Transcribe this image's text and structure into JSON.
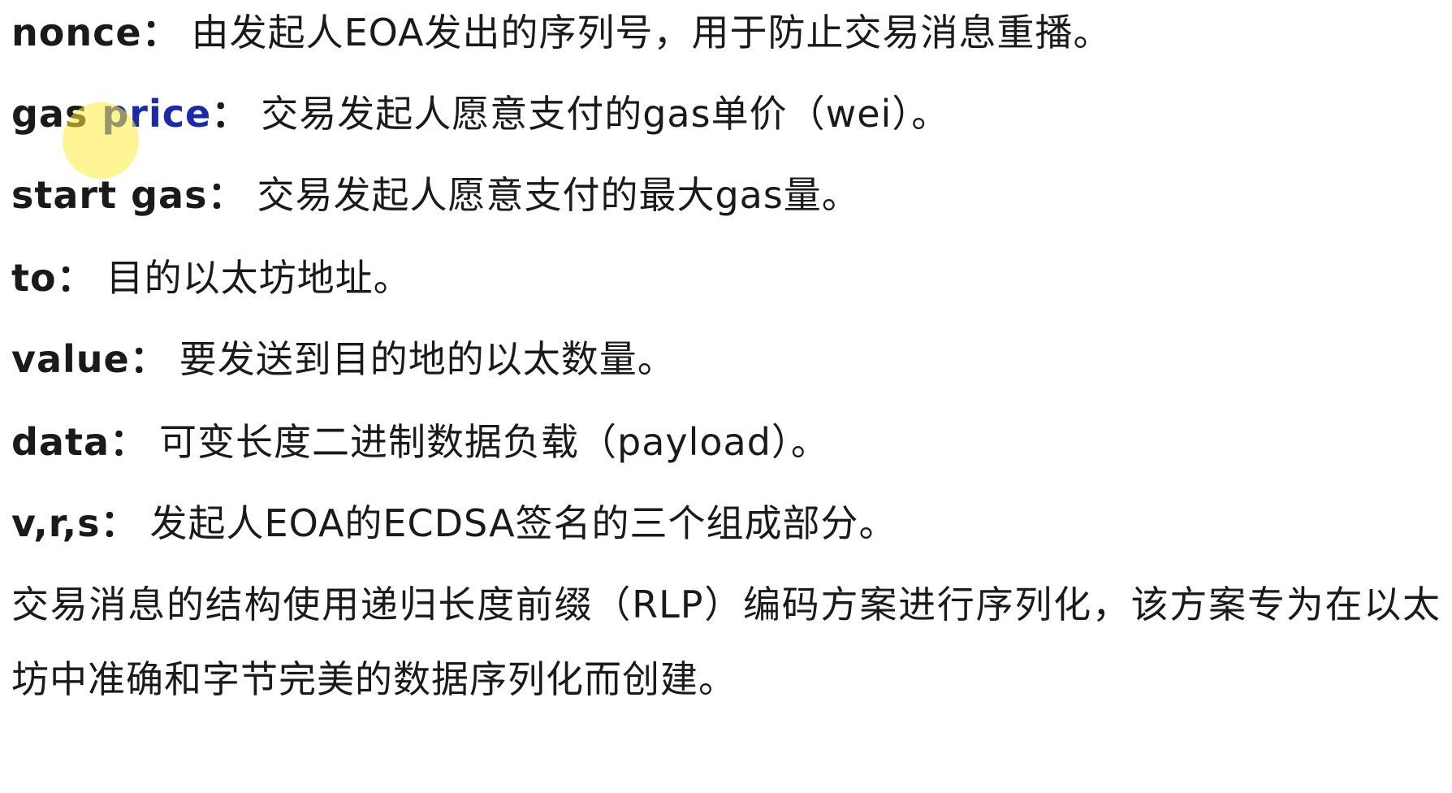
{
  "fields": [
    {
      "term": "nonce",
      "separator": "：",
      "description": "由发起人EOA发出的序列号，用于防止交易消息重播。"
    },
    {
      "term_part1": "gas ",
      "term_highlight": "price",
      "separator": "：",
      "description": "交易发起人愿意支付的gas单价（wei）。"
    },
    {
      "term": "start gas",
      "separator": "：",
      "description": "交易发起人愿意支付的最大gas量。"
    },
    {
      "term": "to",
      "separator": "：",
      "description": "目的以太坊地址。"
    },
    {
      "term": "value",
      "separator": "：",
      "description": "要发送到目的地的以太数量。"
    },
    {
      "term": "data",
      "separator": "：",
      "description": "可变长度二进制数据负载（payload）。"
    },
    {
      "term": "v,r,s",
      "separator": "：",
      "description": "发起人EOA的ECDSA签名的三个组成部分。"
    }
  ],
  "paragraph": "交易消息的结构使用递归长度前缀（RLP）编码方案进行序列化，该方案专为在以太坊中准确和字节完美的数据序列化而创建。",
  "colors": {
    "text": "#1a1a1a",
    "highlight": "#1a2aa8",
    "cursor_highlight": "#ffec3c"
  }
}
